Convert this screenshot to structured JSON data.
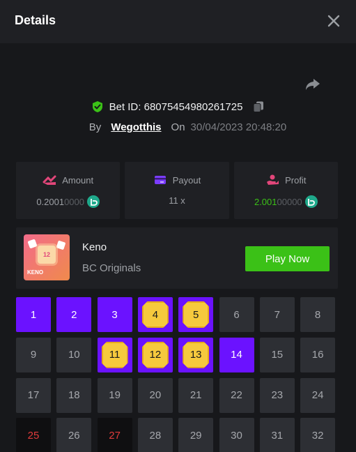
{
  "header": {
    "title": "Details"
  },
  "bet": {
    "id_label": "Bet ID: 68075454980261725",
    "by_label": "By",
    "user": "Wegotthis",
    "on_label": "On",
    "date": "30/04/2023 20:48:20"
  },
  "stats": {
    "amount": {
      "label": "Amount",
      "value_main": "0.2001",
      "value_dim": "0000"
    },
    "payout": {
      "label": "Payout",
      "value": "11 x"
    },
    "profit": {
      "label": "Profit",
      "value_main": "2.001",
      "value_dim": "00000"
    }
  },
  "game": {
    "name": "Keno",
    "provider": "BC Originals",
    "play_label": "Play Now",
    "thumb_number": "12",
    "thumb_text": "KENO"
  },
  "colors": {
    "accent_purple": "#6b12ff",
    "accent_green": "#3bc117",
    "gem_yellow": "#f6c93d",
    "miss_red": "#e03b3b",
    "bg": "#17181b",
    "panel": "#1f2024"
  },
  "icons": [
    "close-icon",
    "share-icon",
    "shield-check-icon",
    "copy-icon",
    "amount-icon",
    "payout-icon",
    "profit-icon",
    "coin-icon"
  ],
  "grid": {
    "cells": [
      {
        "n": "1",
        "state": "picked"
      },
      {
        "n": "2",
        "state": "picked"
      },
      {
        "n": "3",
        "state": "picked"
      },
      {
        "n": "4",
        "state": "hit"
      },
      {
        "n": "5",
        "state": "hit"
      },
      {
        "n": "6",
        "state": "none"
      },
      {
        "n": "7",
        "state": "none"
      },
      {
        "n": "8",
        "state": "none"
      },
      {
        "n": "9",
        "state": "none"
      },
      {
        "n": "10",
        "state": "none"
      },
      {
        "n": "11",
        "state": "hit"
      },
      {
        "n": "12",
        "state": "hit"
      },
      {
        "n": "13",
        "state": "hit"
      },
      {
        "n": "14",
        "state": "picked"
      },
      {
        "n": "15",
        "state": "none"
      },
      {
        "n": "16",
        "state": "none"
      },
      {
        "n": "17",
        "state": "none"
      },
      {
        "n": "18",
        "state": "none"
      },
      {
        "n": "19",
        "state": "none"
      },
      {
        "n": "20",
        "state": "none"
      },
      {
        "n": "21",
        "state": "none"
      },
      {
        "n": "22",
        "state": "none"
      },
      {
        "n": "23",
        "state": "none"
      },
      {
        "n": "24",
        "state": "none"
      },
      {
        "n": "25",
        "state": "miss"
      },
      {
        "n": "26",
        "state": "none"
      },
      {
        "n": "27",
        "state": "miss"
      },
      {
        "n": "28",
        "state": "none"
      },
      {
        "n": "29",
        "state": "none"
      },
      {
        "n": "30",
        "state": "none"
      },
      {
        "n": "31",
        "state": "none"
      },
      {
        "n": "32",
        "state": "none"
      }
    ]
  }
}
